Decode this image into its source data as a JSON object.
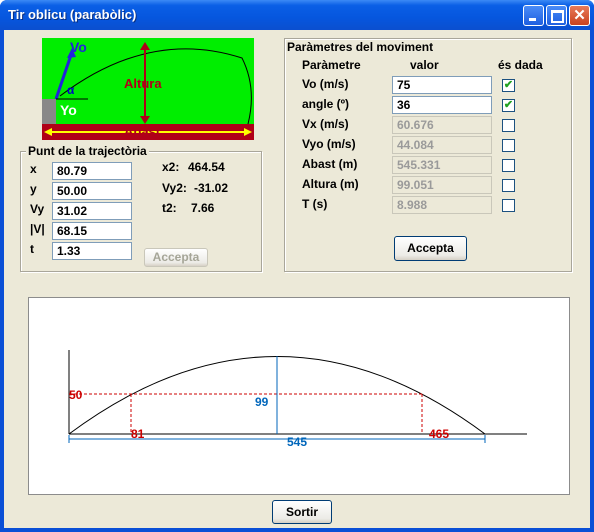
{
  "window": {
    "title": "Tir oblicu (parabòlic)"
  },
  "diagram": {
    "vo_label": "Vo",
    "alpha_label": "α",
    "altura_label": "Altura",
    "yo_label": "Yo",
    "abast_label": "Abast"
  },
  "trajectory": {
    "group_label": "Punt de la trajectòria",
    "fields": [
      {
        "label": "x",
        "value": "80.79"
      },
      {
        "label": "y",
        "value": "50.00"
      },
      {
        "label": "Vy",
        "value": "31.02"
      },
      {
        "label": "|V|",
        "value": "68.15"
      },
      {
        "label": "t",
        "value": "1.33"
      }
    ],
    "results": [
      {
        "label": "x2:",
        "value": "464.54"
      },
      {
        "label": "Vy2:",
        "value": "-31.02"
      },
      {
        "label": "t2:",
        "value": "7.66"
      }
    ],
    "accept_label": "Accepta"
  },
  "params": {
    "group_label": "Paràmetres del moviment",
    "col_param": "Paràmetre",
    "col_value": "valor",
    "col_given": "és dada",
    "rows": [
      {
        "label": "Vo (m/s)",
        "value": "75",
        "given": true,
        "enabled": true
      },
      {
        "label": "angle (º)",
        "value": "36",
        "given": true,
        "enabled": true
      },
      {
        "label": "Vx (m/s)",
        "value": "60.676",
        "given": false,
        "enabled": false
      },
      {
        "label": "Vyo (m/s)",
        "value": "44.084",
        "given": false,
        "enabled": false
      },
      {
        "label": "Abast (m)",
        "value": "545.331",
        "given": false,
        "enabled": false
      },
      {
        "label": "Altura (m)",
        "value": "99.051",
        "given": false,
        "enabled": false
      },
      {
        "label": "T (s)",
        "value": "8.988",
        "given": false,
        "enabled": false
      }
    ],
    "accept_label": "Accepta"
  },
  "plot": {
    "y_point_label": "50",
    "height_label": "99",
    "x1_label": "81",
    "x2_label": "465",
    "range_label": "545",
    "colors": {
      "red": "#cc0000",
      "blue": "#0066bb"
    }
  },
  "footer": {
    "exit_label": "Sortir"
  }
}
